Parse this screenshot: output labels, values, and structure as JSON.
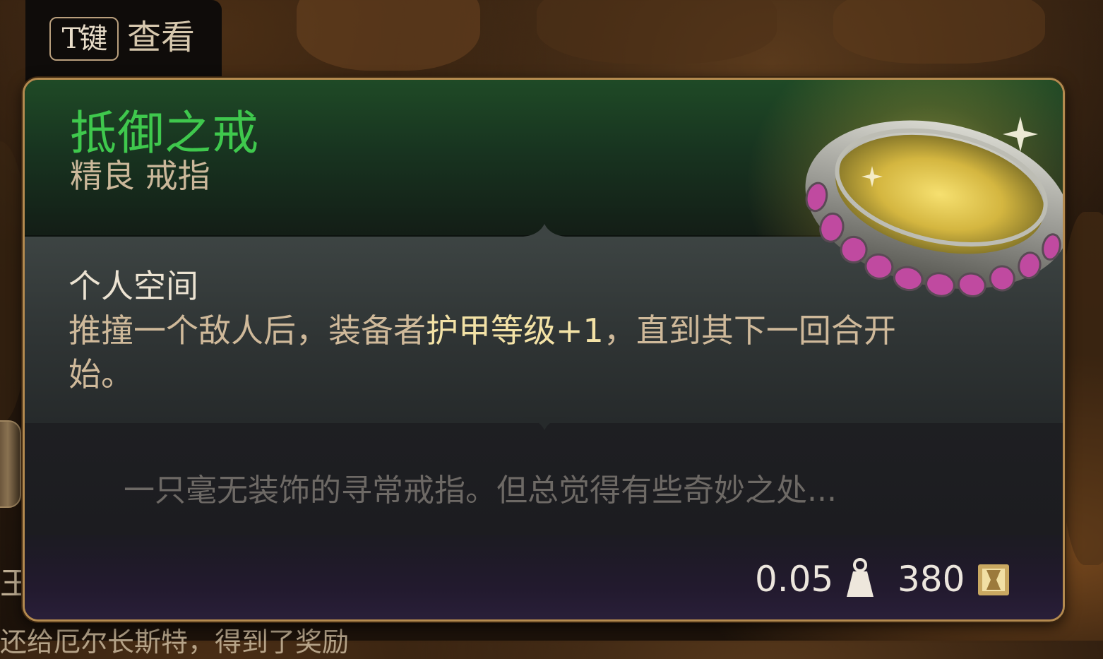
{
  "hint": {
    "key_label": "T键",
    "action_label": "查看"
  },
  "item": {
    "name": "抵御之戒",
    "type": "精良 戒指",
    "effect": {
      "title": "个人空间",
      "desc_before": "推撞一个敌人后，装备者",
      "desc_highlight": "护甲等级+1",
      "desc_after": "，直到其下一回合开始。"
    },
    "flavor": "一只毫无装饰的寻常戒指。但总觉得有些奇妙之处...",
    "weight": "0.05",
    "price": "380",
    "weight_icon": "weight-icon",
    "coin_icon": "gold-coin-icon",
    "image": "ring-image"
  },
  "background": {
    "left_text": "王",
    "bottom_text": "还给厄尔长斯特，得到了奖励"
  },
  "colors": {
    "rarity_uncommon": "#3fc84d",
    "border_gold": "#b48a4f",
    "highlight": "#f3e2a6"
  }
}
